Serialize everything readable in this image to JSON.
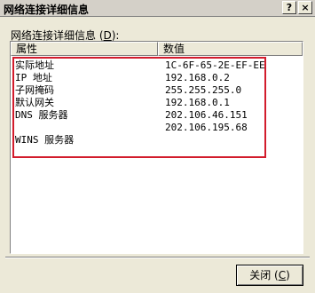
{
  "window": {
    "title": "网络连接详细信息",
    "help_symbol": "?",
    "close_symbol": "×"
  },
  "list": {
    "caption_text": "网络连接详细信息 (",
    "caption_key": "D",
    "caption_end": "):",
    "columns": [
      "属性",
      "数值"
    ],
    "rows": [
      {
        "property": "实际地址",
        "value": "1C-6F-65-2E-EF-EE"
      },
      {
        "property": "IP 地址",
        "value": "192.168.0.2"
      },
      {
        "property": "子网掩码",
        "value": "255.255.255.0"
      },
      {
        "property": "默认网关",
        "value": "192.168.0.1"
      },
      {
        "property": "DNS 服务器",
        "value": "202.106.46.151"
      },
      {
        "property": "",
        "value": "202.106.195.68"
      },
      {
        "property": "WINS 服务器",
        "value": ""
      }
    ]
  },
  "footer": {
    "close_text": "关闭 (",
    "close_key": "C",
    "close_end": ")"
  },
  "colors": {
    "highlight_border": "#d21c2c",
    "dialog_background": "#ece9d8"
  }
}
